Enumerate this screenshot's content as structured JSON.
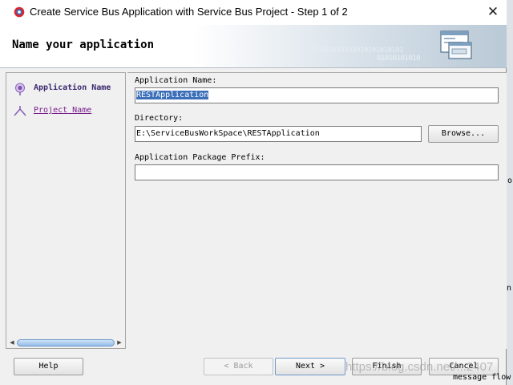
{
  "window": {
    "title": "Create Service Bus Application with Service Bus Project - Step 1 of 2",
    "close_glyph": "✕"
  },
  "banner": {
    "title": "Name your application",
    "binary_text": "010101010101010101010101",
    "binary_text2": "01010101010"
  },
  "steps": [
    {
      "label": "Application Name",
      "state": "current",
      "icon": "step-current-icon"
    },
    {
      "label": "Project Name",
      "state": "link",
      "icon": "step-next-icon"
    }
  ],
  "form": {
    "app_name": {
      "label": "Application Name:",
      "value": "RESTApplication"
    },
    "directory": {
      "label": "Directory:",
      "value": "E:\\ServiceBusWorkSpace\\RESTApplication",
      "browse_label": "Browse..."
    },
    "package_prefix": {
      "label": "Application Package Prefix:",
      "value": ""
    }
  },
  "buttons": {
    "help": "Help",
    "back": "< Back",
    "next": "Next >",
    "finish": "Finish",
    "cancel": "Cancel"
  },
  "background": {
    "fragment_right": "or",
    "fragment_mid": "n",
    "status_text": "message flow"
  },
  "watermark": "https://blog.csdn.net/...2407",
  "colors": {
    "selection": "#3b6fb8",
    "step_current": "#3a2a6e",
    "step_link": "#7a1c8c"
  }
}
